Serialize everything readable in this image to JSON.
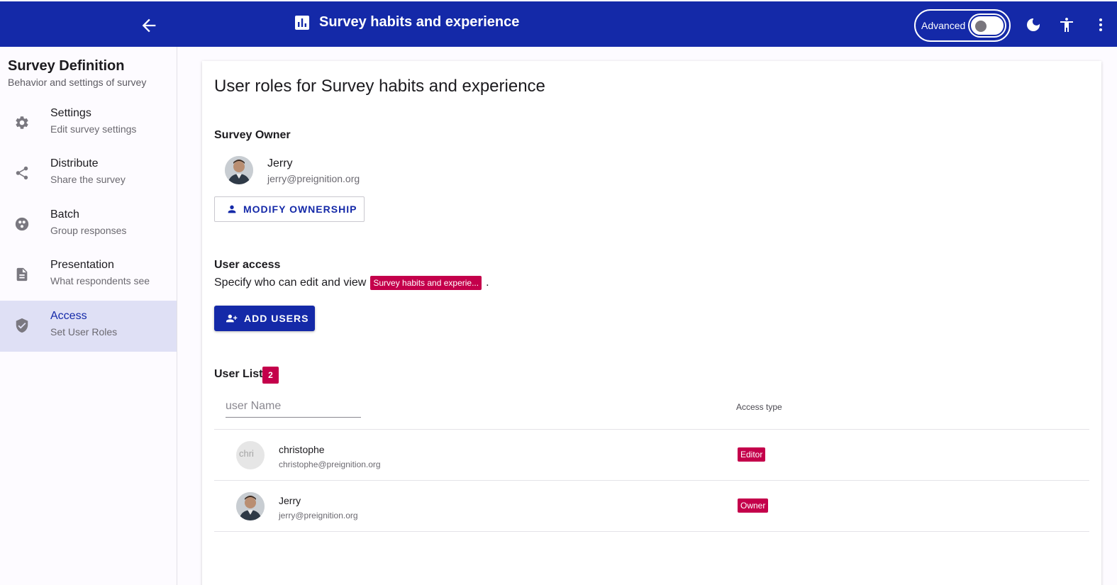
{
  "header": {
    "title": "Survey habits and experience",
    "advanced_label": "Advanced",
    "advanced_on": false,
    "icons": [
      "arrow-back-icon",
      "bar-chart-icon",
      "dark-mode-icon",
      "accessibility-icon",
      "more-vert-icon"
    ]
  },
  "sidebar": {
    "title": "Survey Definition",
    "subtitle": "Behavior and settings of survey",
    "items": [
      {
        "label": "Settings",
        "sub": "Edit survey settings",
        "icon": "gear-icon"
      },
      {
        "label": "Distribute",
        "sub": "Share the survey",
        "icon": "share-icon"
      },
      {
        "label": "Batch",
        "sub": "Group responses",
        "icon": "group-icon"
      },
      {
        "label": "Presentation",
        "sub": "What respondents see",
        "icon": "document-icon"
      },
      {
        "label": "Access",
        "sub": "Set User Roles",
        "icon": "shield-check-icon",
        "active": true
      }
    ]
  },
  "main": {
    "heading": "User roles for Survey habits and experience",
    "owner_section": "Survey Owner",
    "owner": {
      "name": "Jerry",
      "email": "jerry@preignition.org"
    },
    "modify_button": "MODIFY OWNERSHIP",
    "access_section": "User access",
    "access_desc": "Specify who can edit and view",
    "access_chip": "Survey habits and experie...",
    "access_desc_end": ".",
    "add_button": "ADD USERS",
    "list_title": "User List",
    "list_count": "2",
    "filter_placeholder": "user Name",
    "access_type_header": "Access type",
    "users": [
      {
        "name": "christophe",
        "email": "christophe@preignition.org",
        "role": "Editor",
        "avatar_alt": "chri"
      },
      {
        "name": "Jerry",
        "email": "jerry@preignition.org",
        "role": "Owner"
      }
    ]
  },
  "colors": {
    "primary": "#1429a8",
    "accent": "#c4004b",
    "active_bg": "#dfe0f5"
  }
}
